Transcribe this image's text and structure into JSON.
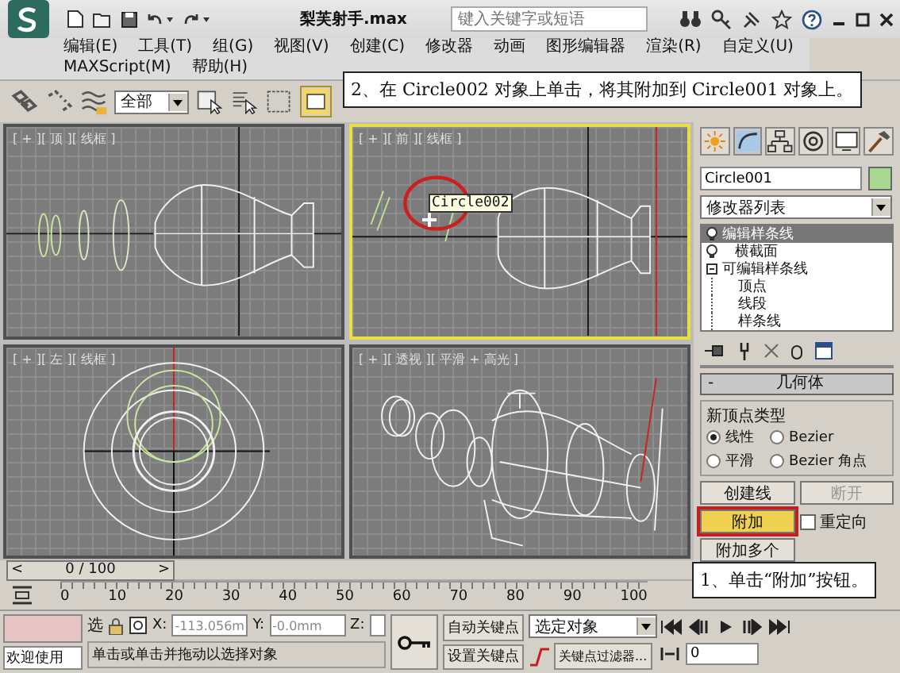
{
  "title_bar": {
    "file_name": "梨芙射手.max",
    "search_placeholder": "键入关键字或短语"
  },
  "menu": [
    "编辑(E)",
    "工具(T)",
    "组(G)",
    "视图(V)",
    "创建(C)",
    "修改器",
    "动画",
    "图形编辑器",
    "渲染(R)",
    "自定义(U)",
    "MAXScript(M)",
    "帮助(H)"
  ],
  "toolbar": {
    "selection_filter": "全部"
  },
  "viewports": [
    {
      "kind": "top",
      "label": "[ + ][ 顶 ][ 线框 ]",
      "selected": false
    },
    {
      "kind": "front",
      "label": "[ + ][ 前 ][ 线框 ]",
      "selected": true,
      "tooltip": "Circle002"
    },
    {
      "kind": "left",
      "label": "[ + ][ 左 ][ 线框 ]",
      "selected": false
    },
    {
      "kind": "perspective",
      "label": "[ + ][ 透视 ][ 平滑 + 高光 ]",
      "selected": false
    }
  ],
  "command_panel": {
    "object_name": "Circle001",
    "modifier_list": "修改器列表",
    "stack": [
      {
        "label": "编辑样条线",
        "selected": true
      },
      {
        "label": "横截面",
        "selected": false
      },
      {
        "label": "可编辑样条线",
        "selected": false,
        "expanded": true,
        "children": [
          {
            "label": "顶点"
          },
          {
            "label": "线段"
          },
          {
            "label": "样条线"
          }
        ]
      }
    ],
    "rollout": {
      "collapse_symbol": "-",
      "title": "几何体",
      "group_title": "新顶点类型",
      "radios": [
        {
          "label": "线性",
          "selected": true
        },
        {
          "label": "Bezier",
          "selected": false
        },
        {
          "label": "平滑",
          "selected": false
        },
        {
          "label": "Bezier 角点",
          "selected": false
        }
      ],
      "buttons": [
        {
          "label": "创建线",
          "disabled": false,
          "active": false
        },
        {
          "label": "断开",
          "disabled": true,
          "active": false
        },
        {
          "label": "附加",
          "disabled": false,
          "active": true
        },
        {
          "label": "附加多个",
          "disabled": false,
          "active": false
        }
      ],
      "checkbox": {
        "label": "重定向",
        "checked": false
      }
    }
  },
  "callouts": [
    {
      "text": "2、在 Circle002 对象上单击，将其附加到 Circle001 对象上。"
    },
    {
      "text": "1、单击“附加”按钮。"
    }
  ],
  "time_slider": {
    "prev": "<",
    "next": ">",
    "level": 0,
    "frame": "0 / 100",
    "ruler": [
      "0",
      "10",
      "20",
      "30",
      "40",
      "50",
      "60",
      "70",
      "80",
      "90",
      "100"
    ]
  },
  "status_bar": {
    "welcome": "欢迎使用",
    "select_label": "选",
    "x_label": "X:",
    "x": "-113.056m",
    "y_label": "Y:",
    "y": "-0.0mm",
    "z_label": "Z:",
    "prompt": "单击或单击并拖动以选择对象",
    "auto_key": "自动关键点",
    "set_key": "设置关键点",
    "key_mode": "选定对象",
    "key_filters": "关键点过滤器...",
    "current_frame": "0"
  }
}
